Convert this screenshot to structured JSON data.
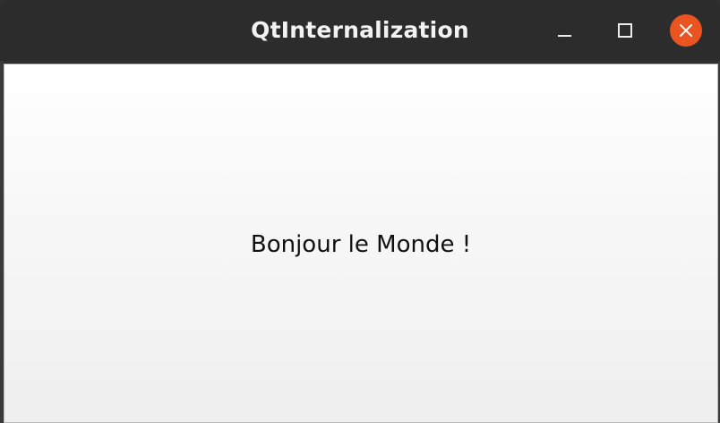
{
  "window": {
    "title": "QtInternalization"
  },
  "titlebar_controls": {
    "minimize_icon": "minimize-icon",
    "maximize_icon": "maximize-icon",
    "close_icon": "close-icon",
    "close_color": "#e95420"
  },
  "content": {
    "label": "Bonjour le Monde !"
  }
}
